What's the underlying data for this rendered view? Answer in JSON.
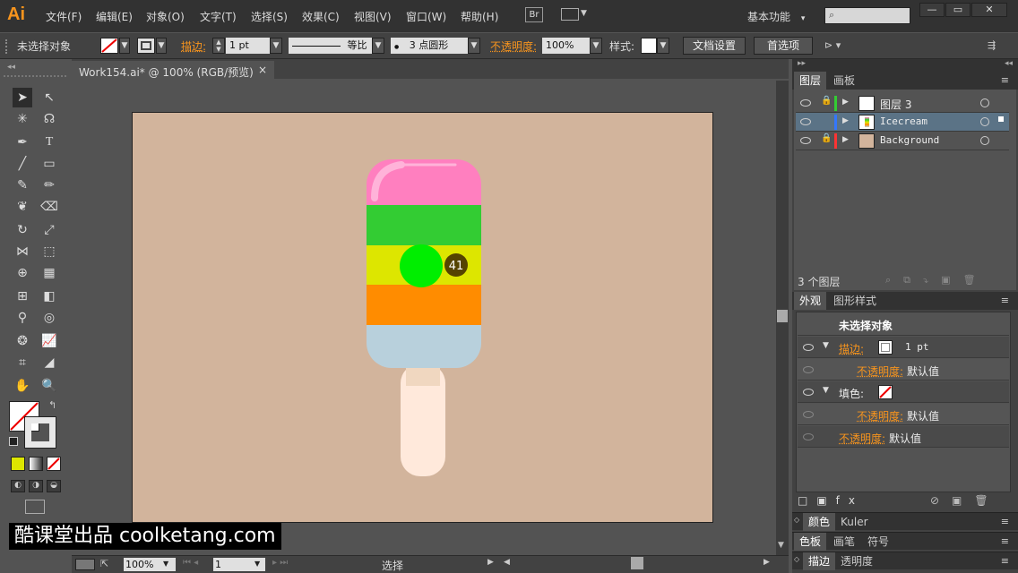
{
  "app": {
    "logo": "Ai"
  },
  "menu": [
    "文件(F)",
    "编辑(E)",
    "对象(O)",
    "文字(T)",
    "选择(S)",
    "效果(C)",
    "视图(V)",
    "窗口(W)",
    "帮助(H)"
  ],
  "menu_badge": "Br",
  "workspace": {
    "label": "基本功能",
    "arrow": "▾"
  },
  "window_buttons": {
    "minimize": "—",
    "restore": "▭",
    "close": "✕"
  },
  "control_bar": {
    "selection": "未选择对象",
    "stroke_label": "描边:",
    "stroke_weight": "1 pt",
    "stroke_profile": "等比",
    "brush": "3 点圆形",
    "opacity_label": "不透明度:",
    "opacity_value": "100%",
    "style_label": "样式:",
    "doc_setup": "文档设置",
    "preferences": "首选项"
  },
  "document": {
    "tab": "Work154.ai* @ 100% (RGB/预览)",
    "close": "×"
  },
  "canvas": {
    "cursor_badge": "41",
    "artboard_color": "#d2b49c",
    "icecream_colors": [
      "#ff7fbf",
      "#33cc33",
      "#dde600",
      "#ff8c00",
      "#b8d0dc",
      "#ffe9db"
    ]
  },
  "status": {
    "zoom": "100%",
    "page": "1",
    "tool": "选择"
  },
  "layers_panel": {
    "tabs": [
      "图层",
      "画板"
    ],
    "layers": [
      {
        "name": "图层 3",
        "color": "#33cc33",
        "locked": true
      },
      {
        "name": "Icecream",
        "color": "#3377ff",
        "locked": false
      },
      {
        "name": "Background",
        "color": "#ff3333",
        "locked": true
      }
    ],
    "count": "3 个图层"
  },
  "appearance_panel": {
    "tabs": [
      "外观",
      "图形样式"
    ],
    "title": "未选择对象",
    "rows": [
      {
        "label": "描边:",
        "value": "1 pt"
      },
      {
        "label": "不透明度:",
        "value": "默认值"
      },
      {
        "label": "填色:",
        "value": ""
      },
      {
        "label": "不透明度:",
        "value": "默认值"
      },
      {
        "label": "不透明度:",
        "value": "默认值"
      }
    ]
  },
  "collapsed_panels": [
    {
      "tabs": [
        "颜色",
        "Kuler"
      ]
    },
    {
      "tabs": [
        "色板",
        "画笔",
        "符号"
      ]
    },
    {
      "tabs": [
        "描边",
        "透明度"
      ]
    }
  ],
  "watermark": "酷课堂出品 coolketang.com"
}
